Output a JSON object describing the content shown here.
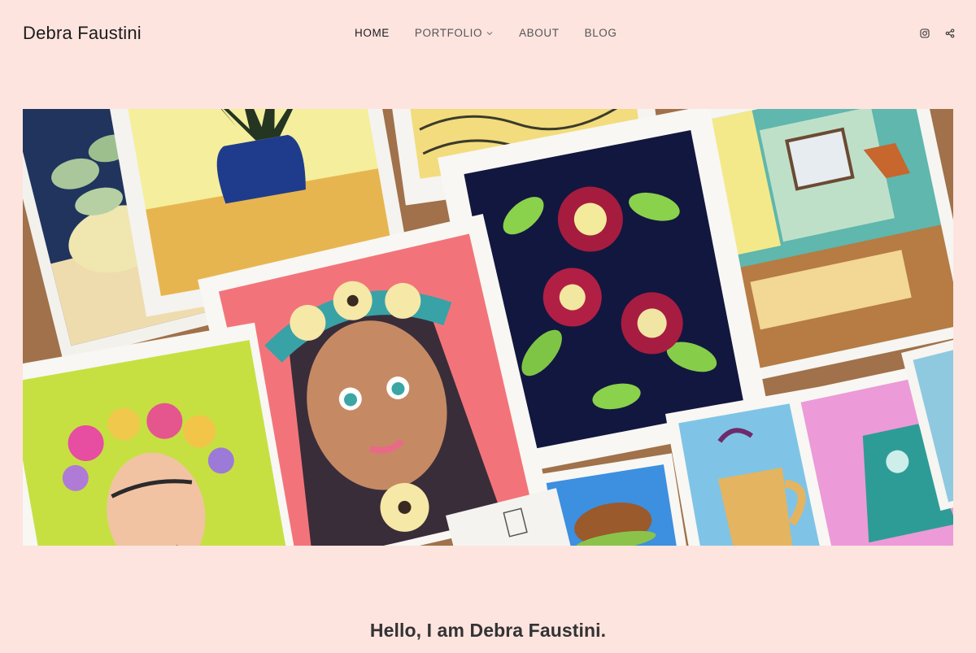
{
  "header": {
    "site_title": "Debra Faustini",
    "nav": [
      {
        "label": "HOME",
        "active": true,
        "has_dropdown": false
      },
      {
        "label": "PORTFOLIO",
        "active": false,
        "has_dropdown": true
      },
      {
        "label": "ABOUT",
        "active": false,
        "has_dropdown": false
      },
      {
        "label": "BLOG",
        "active": false,
        "has_dropdown": false
      }
    ],
    "social_icons": [
      "instagram-icon",
      "share-icon"
    ]
  },
  "hero": {
    "image_subject": "collage of colorful gouache paintings: potted plants, portraits with flower crowns, floral pattern, interior room, coffee mug, kettle"
  },
  "intro": {
    "heading": "Hello, I am Debra Faustini."
  },
  "colors": {
    "background": "#fde4df",
    "text": "#2b2b2b"
  }
}
